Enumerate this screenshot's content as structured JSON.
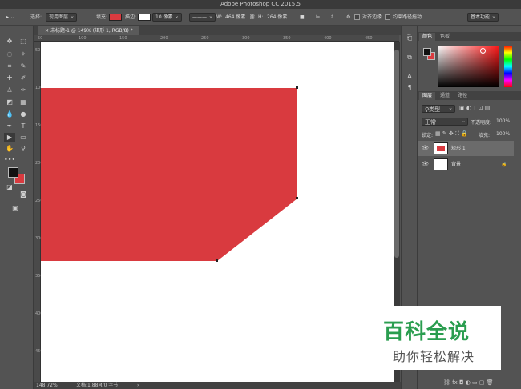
{
  "window": {
    "title": "Adobe Photoshop CC 2015.5"
  },
  "options_bar": {
    "select_label": "选择:",
    "select_value": "现用图层",
    "fill_label": "填充:",
    "fill_color": "#d93a3f",
    "stroke_label": "描边:",
    "stroke_width": "10 像素",
    "w_label": "W:",
    "w_value": "464 像素",
    "h_label": "H:",
    "h_value": "264 像素",
    "align_edges": "对齐边缘",
    "constrain_path": "约束路径拖动",
    "workspace": "基本功能"
  },
  "document": {
    "tab_label": "未标题-1 @ 149% (矩形 1, RGB/8) *",
    "zoom": "148.72%",
    "doc_info": "文档:1.88M/0 字节",
    "shape_color": "#d93a3f"
  },
  "rulers": {
    "top": [
      "50",
      "100",
      "150",
      "200",
      "250",
      "300",
      "350",
      "400",
      "450",
      "500"
    ],
    "left": [
      "50",
      "100",
      "150",
      "200",
      "250",
      "300",
      "350",
      "400",
      "450"
    ]
  },
  "color_panel": {
    "tabs": [
      "颜色",
      "色板"
    ],
    "fg": "#111111",
    "bg": "#d93a3f"
  },
  "layers_panel": {
    "tabs": [
      "图层",
      "通道",
      "路径"
    ],
    "filter_kind": "类型",
    "blend_mode": "正常",
    "opacity_label": "不透明度:",
    "opacity_value": "100%",
    "lock_label": "锁定:",
    "fill_label": "填充:",
    "fill_value": "100%",
    "layers": [
      {
        "name": "矩形 1",
        "selected": true
      },
      {
        "name": "背景",
        "selected": false
      }
    ]
  },
  "watermark": {
    "main": "百科全说",
    "sub": "助你轻松解决"
  }
}
